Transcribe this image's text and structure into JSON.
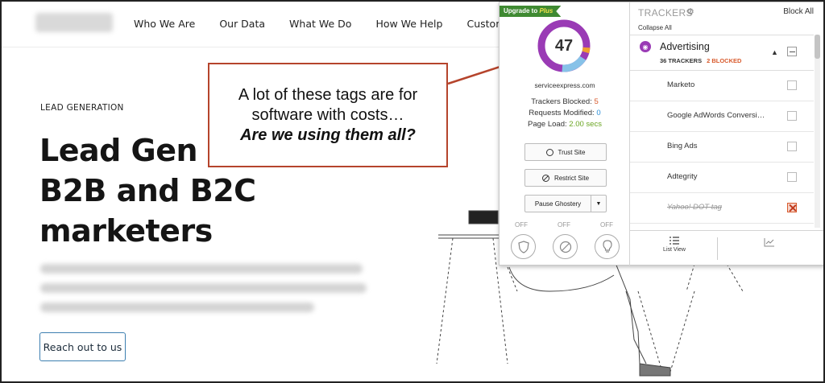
{
  "site": {
    "nav": [
      "Who We Are",
      "Our Data",
      "What We Do",
      "How We Help",
      "Customer Success"
    ],
    "eyebrow": "LEAD GENERATION",
    "hero_lines": [
      "Lead Gen s",
      "B2B and B2C",
      "marketers"
    ],
    "cta_label": "Reach out to us"
  },
  "callout": {
    "line1": "A lot of these tags are for",
    "line2": "software with costs…",
    "line3": "Are we using them all?",
    "border_color": "#b5442c"
  },
  "ghostery": {
    "upgrade_label": "Upgrade to",
    "upgrade_plus": "Plus",
    "tracker_count": "47",
    "domain": "serviceexpress.com",
    "stats": {
      "blocked_label": "Trackers Blocked:",
      "blocked_value": "5",
      "modified_label": "Requests Modified:",
      "modified_value": "0",
      "load_label": "Page Load:",
      "load_value": "2.00 secs"
    },
    "trust_label": "Trust Site",
    "restrict_label": "Restrict Site",
    "pause_label": "Pause Ghostery",
    "off_labels": [
      "OFF",
      "OFF",
      "OFF"
    ],
    "panel_title": "TRACKERS",
    "block_all": "Block All",
    "collapse_all": "Collapse All",
    "category": {
      "name": "Advertising",
      "trackers": "36 TRACKERS",
      "blocked": "2 BLOCKED"
    },
    "trackers": [
      {
        "name": "Marketo",
        "blocked": false
      },
      {
        "name": "Google AdWords Conversi…",
        "blocked": false
      },
      {
        "name": "Bing Ads",
        "blocked": false
      },
      {
        "name": "Adtegrity",
        "blocked": false
      },
      {
        "name": "Yahoo! DOT tag",
        "blocked": true
      }
    ],
    "list_view_label": "List View",
    "colors": {
      "advertising": "#9a3bb5",
      "analytics": "#87c2e8",
      "other": "#f0a030",
      "blocked": "#d85a2c",
      "modified": "#2c8fd8",
      "load": "#6aa522"
    }
  }
}
